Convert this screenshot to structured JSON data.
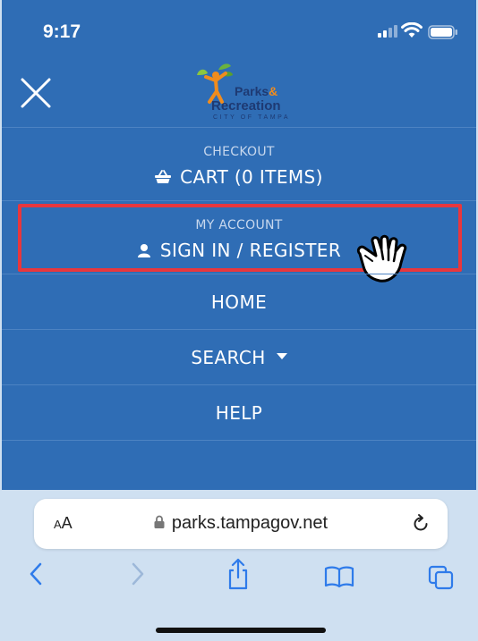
{
  "status_bar": {
    "time": "9:17"
  },
  "header": {
    "logo": {
      "line1": "Parks",
      "amp": "&",
      "line2": "Recreation",
      "line3": "CITY OF TAMPA"
    }
  },
  "menu": {
    "checkout": {
      "caption": "CHECKOUT",
      "label": "CART (0 ITEMS)"
    },
    "account": {
      "caption": "MY ACCOUNT",
      "label": "SIGN IN / REGISTER"
    },
    "home": {
      "label": "HOME"
    },
    "search": {
      "label": "SEARCH"
    },
    "help": {
      "label": "HELP"
    }
  },
  "browser": {
    "text_size": "AA",
    "url": "parks.tampagov.net"
  },
  "colors": {
    "menu_bg": "#2f6db5",
    "highlight": "#e8373d",
    "browser_bg": "#cfe0f1"
  }
}
